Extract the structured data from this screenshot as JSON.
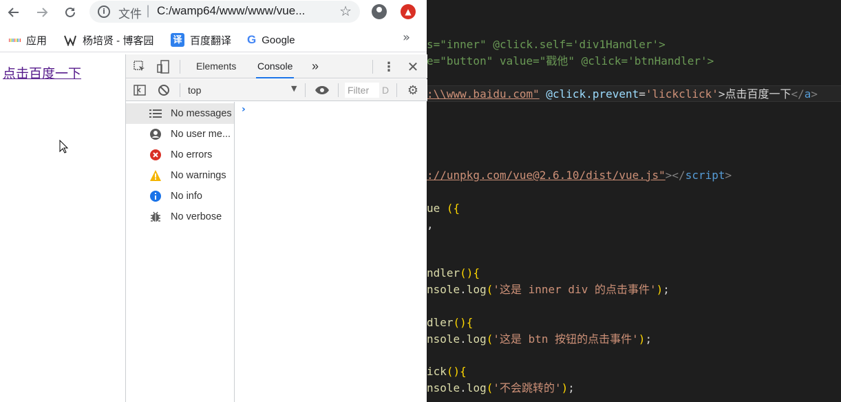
{
  "browser": {
    "omnibox": {
      "security_chip": "文件",
      "separator": "|",
      "url": "C:/wamp64/www/www/vue..."
    },
    "bookmarks": [
      {
        "label": "应用",
        "icon": "apps-grid-icon"
      },
      {
        "label": "杨培贤 - 博客园",
        "icon": "blog-icon"
      },
      {
        "label": "百度翻译",
        "icon": "translate-icon",
        "icon_text": "译"
      },
      {
        "label": "Google",
        "icon": "google-icon",
        "icon_text": "G"
      }
    ],
    "more_bookmarks": "»"
  },
  "page": {
    "link_text": "点击百度一下"
  },
  "devtools": {
    "tabs": [
      {
        "label": "Elements",
        "active": false
      },
      {
        "label": "Console",
        "active": true
      }
    ],
    "overflow": "»",
    "context": "top",
    "filter_placeholder": "Filter",
    "levels_label": "D",
    "sidebar": [
      {
        "label": "No messages",
        "icon": "list-icon",
        "selected": true
      },
      {
        "label": "No user me...",
        "icon": "user-icon",
        "selected": false
      },
      {
        "label": "No errors",
        "icon": "error-icon",
        "selected": false
      },
      {
        "label": "No warnings",
        "icon": "warning-icon",
        "selected": false
      },
      {
        "label": "No info",
        "icon": "info-icon",
        "selected": false
      },
      {
        "label": "No verbose",
        "icon": "bug-icon",
        "selected": false
      }
    ],
    "prompt": "›"
  },
  "colors": {
    "accent": "#1a73e8",
    "error": "#d93025",
    "warning": "#f4b400",
    "info": "#1a73e8",
    "editor_bg": "#1e1e1e"
  }
}
